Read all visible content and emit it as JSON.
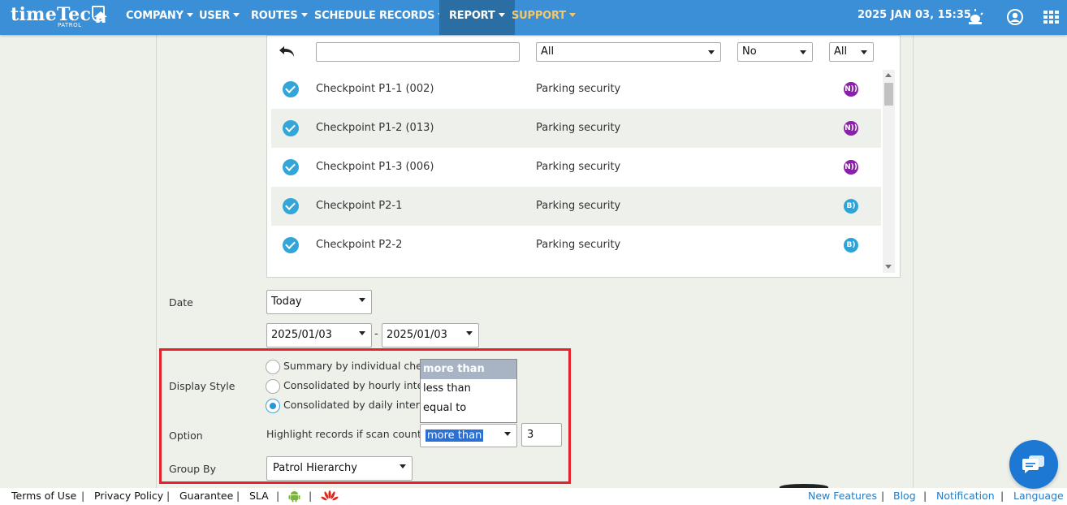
{
  "brand": {
    "name": "timeTec",
    "sub": "PATROL"
  },
  "nav": {
    "items": [
      "COMPANY",
      "USER",
      "ROUTES",
      "SCHEDULE",
      "RECORDS",
      "REPORT",
      "SUPPORT"
    ],
    "clock": "2025 JAN 03, 15:35"
  },
  "checkpoints": {
    "filter": {
      "search_value": "",
      "group": "All",
      "flag": "No",
      "type": "All"
    },
    "rows": [
      {
        "name": "Checkpoint P1-1 (002)",
        "group": "Parking security",
        "tag": "nfc",
        "checked": true
      },
      {
        "name": "Checkpoint P1-2 (013)",
        "group": "Parking security",
        "tag": "nfc",
        "checked": true
      },
      {
        "name": "Checkpoint P1-3 (006)",
        "group": "Parking security",
        "tag": "nfc",
        "checked": true
      },
      {
        "name": "Checkpoint P2-1",
        "group": "Parking security",
        "tag": "ble",
        "checked": true
      },
      {
        "name": "Checkpoint P2-2",
        "group": "Parking security",
        "tag": "ble",
        "checked": true
      }
    ]
  },
  "form": {
    "date_label": "Date",
    "date_range": "Today",
    "date_from": "2025/01/03",
    "date_separator": "-",
    "date_to": "2025/01/03",
    "display_style_label": "Display Style",
    "display_styles": [
      {
        "label": "Summary by individual checkpoint",
        "selected": false
      },
      {
        "label": "Consolidated by hourly interval",
        "selected": false
      },
      {
        "label": "Consolidated by daily interval",
        "selected": true
      }
    ],
    "option_label": "Option",
    "highlight_text": "Highlight records if scan counts",
    "comparison_value": "more than",
    "comparison_options": [
      "more than",
      "less than",
      "equal to"
    ],
    "count_value": "3",
    "group_by_label": "Group By",
    "group_by_value": "Patrol Hierarchy"
  },
  "footer": {
    "left": [
      "Terms of Use",
      "Privacy Policy",
      "Guarantee",
      "SLA"
    ],
    "right": [
      "New Features",
      "Blog",
      "Notification",
      "Language"
    ]
  },
  "colors": {
    "nav_bg": "#3a8fd6",
    "accent": "#33a6d9",
    "highlight_border": "#e4222b",
    "support": "#f4c86a"
  }
}
